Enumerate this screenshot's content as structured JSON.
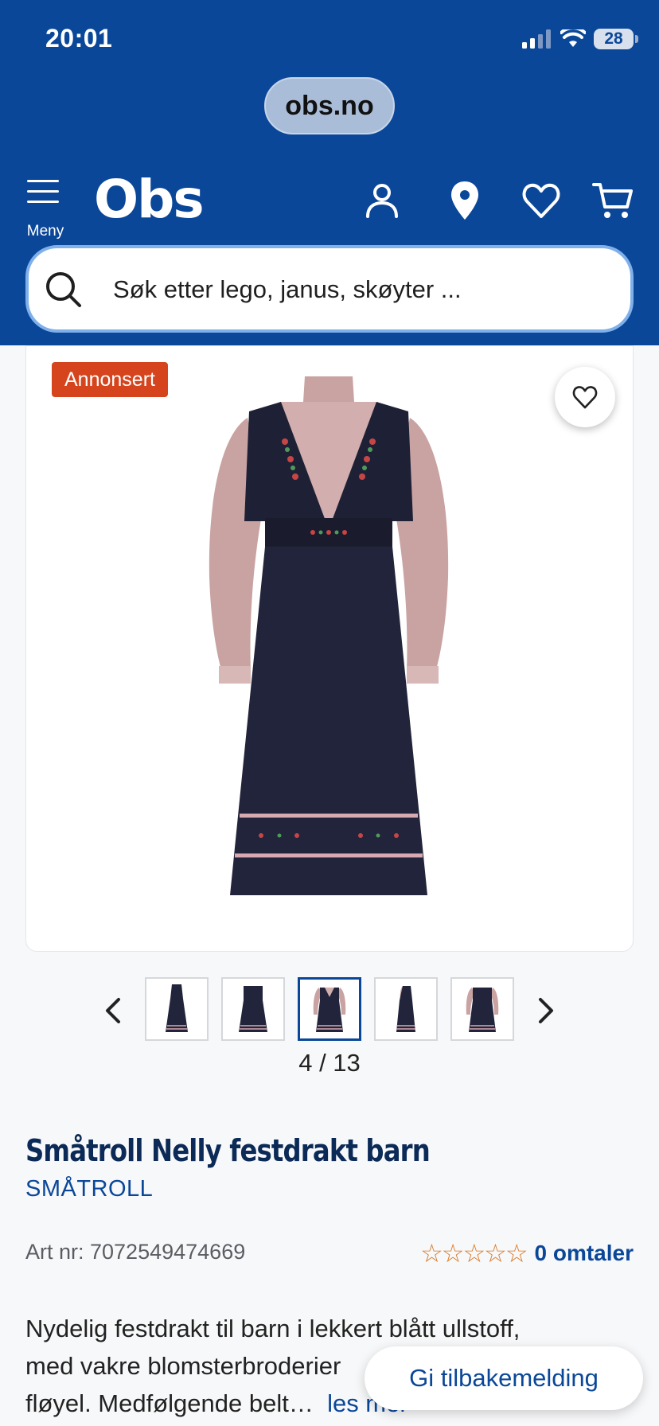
{
  "status_bar": {
    "time": "20:01",
    "battery": "28"
  },
  "browser": {
    "url": "obs.no"
  },
  "header": {
    "menu_label": "Meny",
    "logo": "Obs",
    "search_placeholder": "Søk etter lego, janus, skøyter ..."
  },
  "product_image": {
    "badge": "Annonsert"
  },
  "gallery": {
    "pager": "4 / 13",
    "current_index": 4,
    "total": 13
  },
  "product": {
    "title": "Småtroll Nelly festdrakt barn",
    "brand": "SMÅTROLL",
    "art_nr": "Art nr: 7072549474669",
    "rating_stars": "☆☆☆☆☆",
    "rating_value": 0,
    "reviews": "0 omtaler",
    "description_lines": [
      "Nydelig festdrakt til barn i lekkert blått ullstoff,",
      "med vakre blomsterbroderier",
      "fløyel. Medfølgende belt…"
    ],
    "read_more": "les mer"
  },
  "feedback_button": "Gi tilbakemelding",
  "colors": {
    "brand_blue": "#0b4799",
    "ad_badge": "#d5441c",
    "star": "#d77a2c"
  },
  "icons": {
    "user": "user-icon",
    "store": "location-pin-icon",
    "favorites": "heart-icon",
    "cart": "cart-icon",
    "search": "search-icon"
  }
}
